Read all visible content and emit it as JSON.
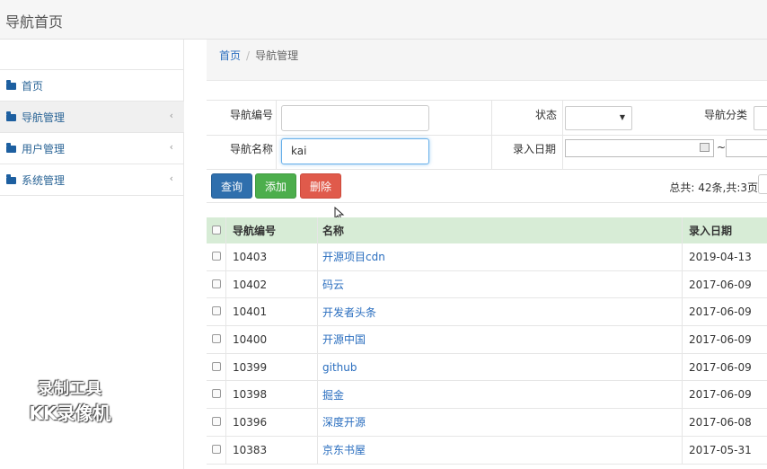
{
  "app": {
    "title": "导航首页"
  },
  "sidebar": {
    "items": [
      {
        "label": "首页",
        "chevron": ""
      },
      {
        "label": "导航管理",
        "chevron": "‹"
      },
      {
        "label": "用户管理",
        "chevron": "‹"
      },
      {
        "label": "系统管理",
        "chevron": "‹"
      }
    ]
  },
  "breadcrumb": {
    "home": "首页",
    "separator": "/",
    "current": "导航管理"
  },
  "search": {
    "nav_id_label": "导航编号",
    "nav_id_value": "",
    "status_label": "状态",
    "status_value": "",
    "category_label": "导航分类",
    "nav_name_label": "导航名称",
    "nav_name_value": "kai",
    "date_label": "录入日期",
    "date_sep": "~"
  },
  "buttons": {
    "query": "查询",
    "add": "添加",
    "delete": "删除"
  },
  "pagination": {
    "summary": "总共: 42条,共:3页"
  },
  "table": {
    "headers": {
      "id": "导航编号",
      "name": "名称",
      "date": "录入日期"
    },
    "rows": [
      {
        "id": "10403",
        "name": "开源项目cdn",
        "date": "2019-04-13"
      },
      {
        "id": "10402",
        "name": "码云",
        "date": "2017-06-09"
      },
      {
        "id": "10401",
        "name": "开发者头条",
        "date": "2017-06-09"
      },
      {
        "id": "10400",
        "name": "开源中国",
        "date": "2017-06-09"
      },
      {
        "id": "10399",
        "name": "github",
        "date": "2017-06-09"
      },
      {
        "id": "10398",
        "name": "掘金",
        "date": "2017-06-09"
      },
      {
        "id": "10396",
        "name": "深度开源",
        "date": "2017-06-08"
      },
      {
        "id": "10383",
        "name": "京东书屋",
        "date": "2017-05-31"
      }
    ]
  },
  "watermark": {
    "line1": "录制工具",
    "line2": "KK录像机"
  },
  "colors": {
    "brand_blue": "#2a6ebf",
    "query_btn": "#2f6fad",
    "add_btn": "#4cae4c",
    "delete_btn": "#e05a4b",
    "table_header": "#d7ecd6"
  }
}
